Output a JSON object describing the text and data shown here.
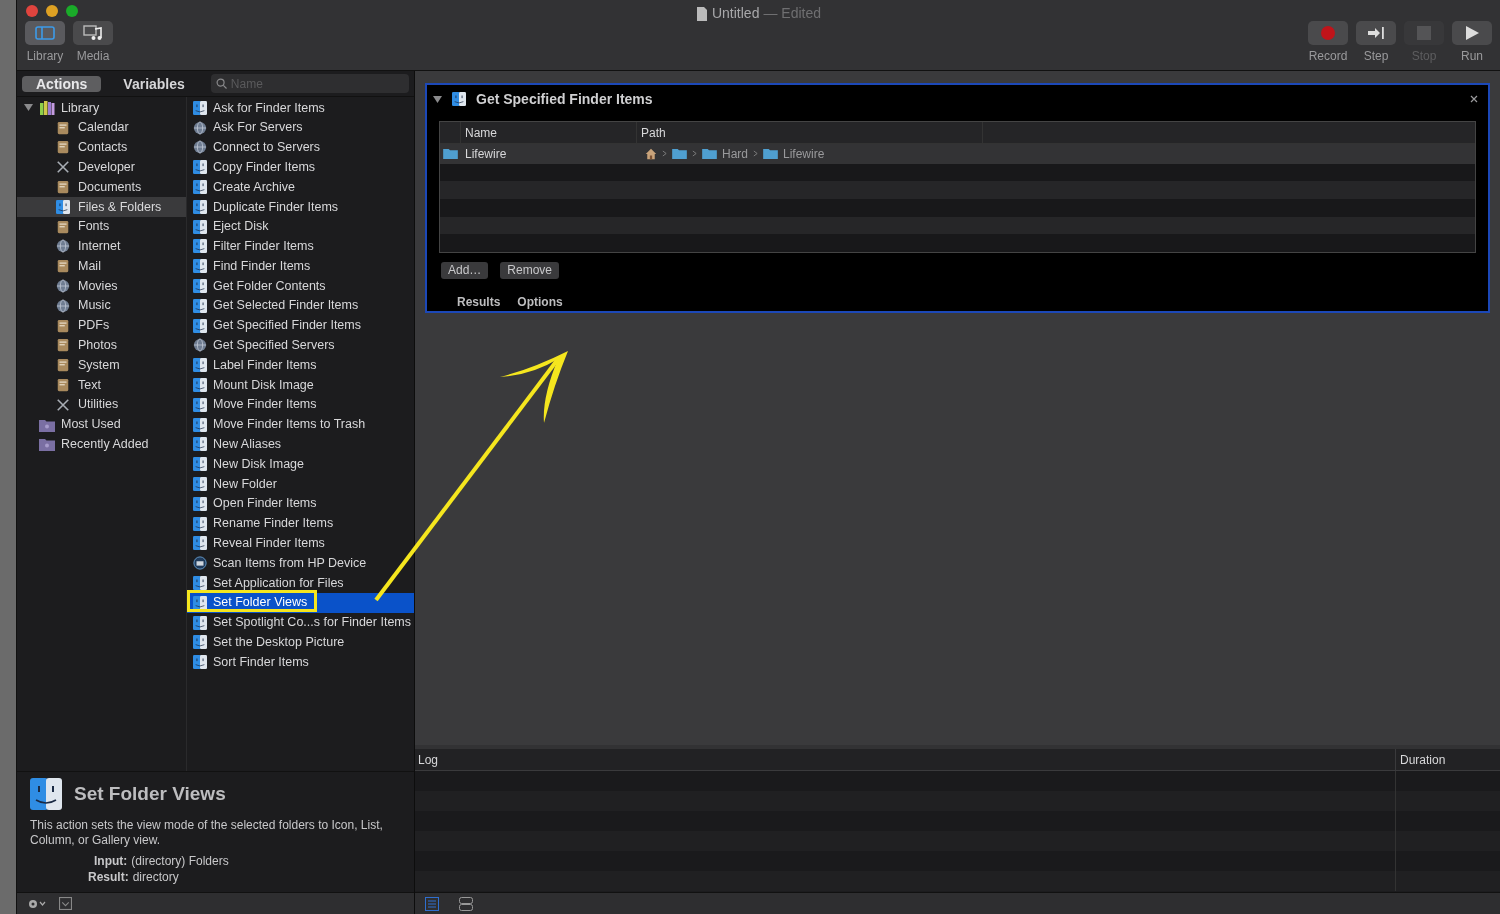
{
  "window": {
    "title": "Untitled",
    "status": "— Edited"
  },
  "toolbar_left": [
    {
      "label": "Library",
      "kind": "library",
      "selected": true
    },
    {
      "label": "Media",
      "kind": "media",
      "selected": false
    }
  ],
  "toolbar_right": [
    {
      "label": "Record",
      "kind": "record",
      "disabled": false
    },
    {
      "label": "Step",
      "kind": "step",
      "disabled": false
    },
    {
      "label": "Stop",
      "kind": "stop",
      "disabled": true
    },
    {
      "label": "Run",
      "kind": "run",
      "disabled": false
    }
  ],
  "tabs": [
    {
      "label": "Actions",
      "selected": true
    },
    {
      "label": "Variables",
      "selected": false
    }
  ],
  "search": {
    "placeholder": "Name"
  },
  "sidebar": [
    {
      "label": "Library",
      "kind": "library",
      "expanded": true,
      "selected": false,
      "children": [
        {
          "label": "Calendar",
          "kind": "category",
          "selected": false
        },
        {
          "label": "Contacts",
          "kind": "category",
          "selected": false
        },
        {
          "label": "Developer",
          "kind": "tools",
          "selected": false
        },
        {
          "label": "Documents",
          "kind": "category",
          "selected": false
        },
        {
          "label": "Files & Folders",
          "kind": "finder",
          "selected": true
        },
        {
          "label": "Fonts",
          "kind": "category",
          "selected": false
        },
        {
          "label": "Internet",
          "kind": "globe",
          "selected": false
        },
        {
          "label": "Mail",
          "kind": "category",
          "selected": false
        },
        {
          "label": "Movies",
          "kind": "globe",
          "selected": false
        },
        {
          "label": "Music",
          "kind": "globe",
          "selected": false
        },
        {
          "label": "PDFs",
          "kind": "category",
          "selected": false
        },
        {
          "label": "Photos",
          "kind": "category",
          "selected": false
        },
        {
          "label": "System",
          "kind": "category",
          "selected": false
        },
        {
          "label": "Text",
          "kind": "category",
          "selected": false
        },
        {
          "label": "Utilities",
          "kind": "tools",
          "selected": false
        }
      ]
    },
    {
      "label": "Most Used",
      "kind": "smart",
      "selected": false
    },
    {
      "label": "Recently Added",
      "kind": "smart",
      "selected": false
    }
  ],
  "actions": [
    {
      "label": "Ask for Finder Items",
      "kind": "finder",
      "selected": false
    },
    {
      "label": "Ask For Servers",
      "kind": "server",
      "selected": false
    },
    {
      "label": "Connect to Servers",
      "kind": "server",
      "selected": false
    },
    {
      "label": "Copy Finder Items",
      "kind": "finder",
      "selected": false
    },
    {
      "label": "Create Archive",
      "kind": "finder",
      "selected": false
    },
    {
      "label": "Duplicate Finder Items",
      "kind": "finder",
      "selected": false
    },
    {
      "label": "Eject Disk",
      "kind": "finder",
      "selected": false
    },
    {
      "label": "Filter Finder Items",
      "kind": "finder",
      "selected": false
    },
    {
      "label": "Find Finder Items",
      "kind": "finder",
      "selected": false
    },
    {
      "label": "Get Folder Contents",
      "kind": "finder",
      "selected": false
    },
    {
      "label": "Get Selected Finder Items",
      "kind": "finder",
      "selected": false
    },
    {
      "label": "Get Specified Finder Items",
      "kind": "finder",
      "selected": false
    },
    {
      "label": "Get Specified Servers",
      "kind": "server",
      "selected": false
    },
    {
      "label": "Label Finder Items",
      "kind": "finder",
      "selected": false
    },
    {
      "label": "Mount Disk Image",
      "kind": "finder",
      "selected": false
    },
    {
      "label": "Move Finder Items",
      "kind": "finder",
      "selected": false
    },
    {
      "label": "Move Finder Items to Trash",
      "kind": "finder",
      "selected": false
    },
    {
      "label": "New Aliases",
      "kind": "finder",
      "selected": false
    },
    {
      "label": "New Disk Image",
      "kind": "finder",
      "selected": false
    },
    {
      "label": "New Folder",
      "kind": "finder",
      "selected": false
    },
    {
      "label": "Open Finder Items",
      "kind": "finder",
      "selected": false
    },
    {
      "label": "Rename Finder Items",
      "kind": "finder",
      "selected": false
    },
    {
      "label": "Reveal Finder Items",
      "kind": "finder",
      "selected": false
    },
    {
      "label": "Scan Items from HP Device",
      "kind": "scanner",
      "selected": false
    },
    {
      "label": "Set Application for Files",
      "kind": "finder",
      "selected": false
    },
    {
      "label": "Set Folder Views",
      "kind": "finder",
      "selected": true
    },
    {
      "label": "Set Spotlight Co...s for Finder Items",
      "kind": "finder",
      "selected": false
    },
    {
      "label": "Set the Desktop Picture",
      "kind": "finder",
      "selected": false
    },
    {
      "label": "Sort Finder Items",
      "kind": "finder",
      "selected": false
    }
  ],
  "description": {
    "title": "Set Folder Views",
    "text": "This action sets the view mode of the selected folders to Icon, List, Column, or Gallery view.",
    "input_label": "Input:",
    "input_value": "(directory) Folders",
    "result_label": "Result:",
    "result_value": "directory"
  },
  "workflow_action": {
    "title": "Get Specified Finder Items",
    "expanded": true,
    "columns": [
      "Name",
      "Path"
    ],
    "rows": [
      {
        "name": "Lifewire",
        "path": [
          {
            "kind": "home"
          },
          {
            "kind": "folder"
          },
          {
            "kind": "folder",
            "label": "Hard"
          },
          {
            "kind": "folder",
            "label": "Lifewire"
          }
        ]
      }
    ],
    "buttons": [
      "Add…",
      "Remove"
    ],
    "footer_tabs": [
      {
        "label": "Results",
        "selected": false
      },
      {
        "label": "Options",
        "selected": false
      }
    ]
  },
  "log": {
    "columns": [
      "Log",
      "Duration"
    ]
  }
}
